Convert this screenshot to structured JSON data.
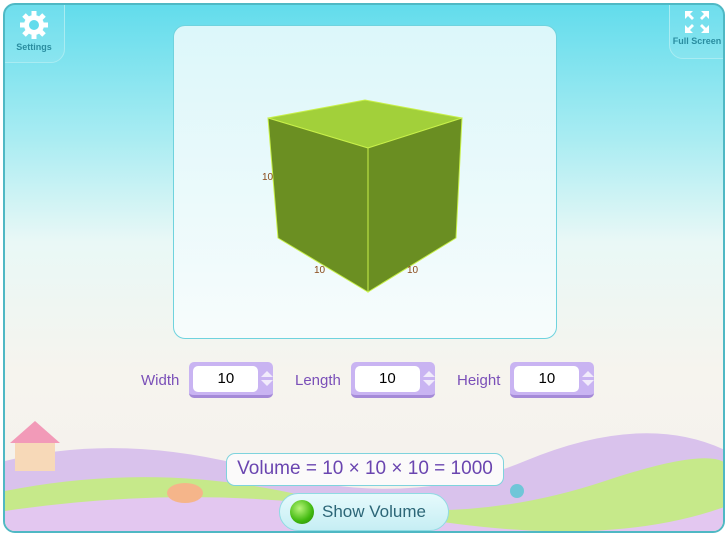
{
  "header": {
    "settings_label": "Settings",
    "fullscreen_label": "Full Screen"
  },
  "cube": {
    "color_top": "#a2d03a",
    "color_front": "#6b8f22",
    "edge_color": "#c8f04a",
    "labels": {
      "height": "10",
      "width": "10",
      "length": "10"
    }
  },
  "controls": [
    {
      "label": "Width",
      "value": "10"
    },
    {
      "label": "Length",
      "value": "10"
    },
    {
      "label": "Height",
      "value": "10"
    }
  ],
  "formula": "Volume = 10 × 10 × 10 = 1000",
  "show_volume": {
    "label": "Show Volume",
    "indicator_color": "#3fb80e"
  }
}
